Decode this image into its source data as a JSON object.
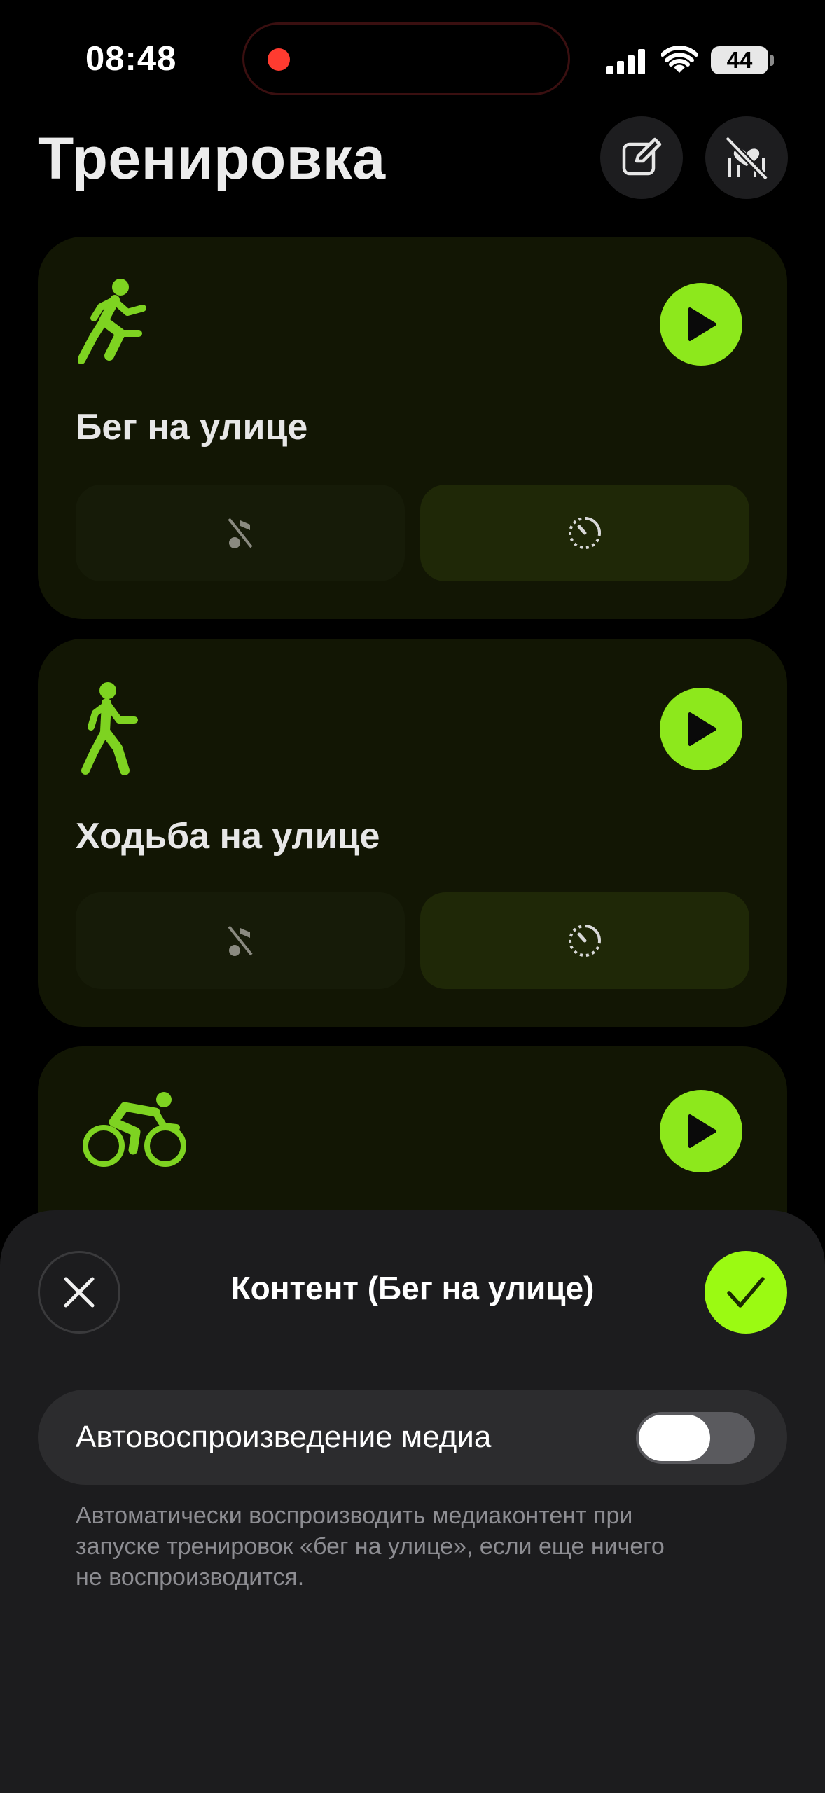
{
  "status_bar": {
    "time": "08:48",
    "battery": "44"
  },
  "page": {
    "title": "Тренировка"
  },
  "workouts": [
    {
      "name": "Бег на улице",
      "icon": "running-figure-icon"
    },
    {
      "name": "Ходьба на улице",
      "icon": "walking-figure-icon"
    },
    {
      "name": "",
      "icon": "cycling-figure-icon"
    }
  ],
  "sheet": {
    "title": "Контент (Бег на улице)",
    "setting_label": "Автовоспроизведение медиа",
    "toggle_on": false,
    "footnote": "Автоматически воспроизводить медиаконтент при запуске тренировок «бег на улице», если еще ничего не воспроизводится."
  },
  "colors": {
    "accent": "#8de81c",
    "confirm": "#9bfa12",
    "card": "#121604",
    "sheet": "#1c1c1e"
  }
}
